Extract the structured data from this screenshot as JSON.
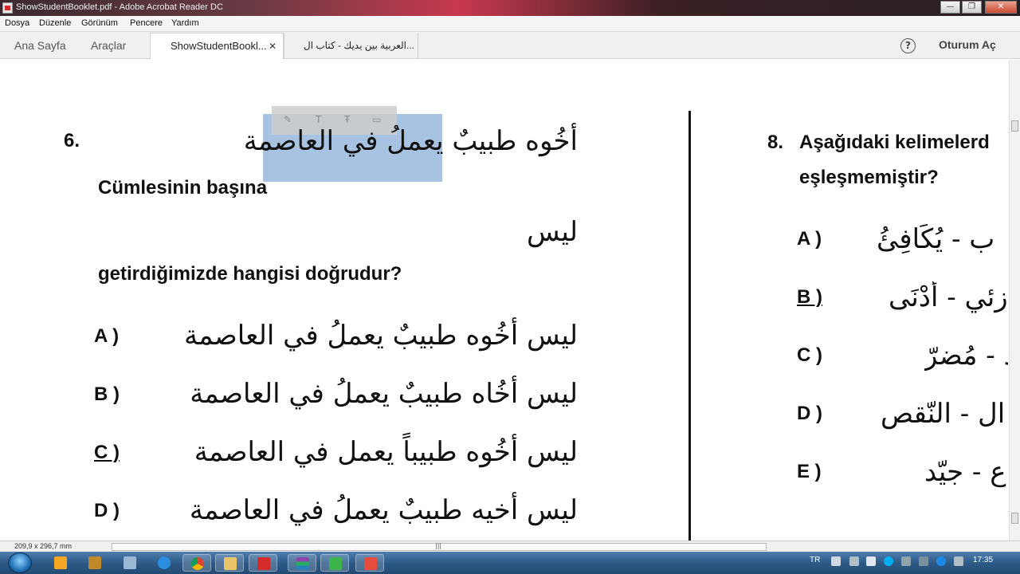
{
  "window": {
    "title": "ShowStudentBooklet.pdf - Adobe Acrobat Reader DC",
    "min_glyph": "—",
    "max_glyph": "❐",
    "close_glyph": "✕"
  },
  "menu": [
    "Dosya",
    "Düzenle",
    "Görünüm",
    "Pencere",
    "Yardım"
  ],
  "nav": {
    "home": "Ana Sayfa",
    "tools": "Araçlar",
    "tabs": [
      {
        "label": "ShowStudentBookl...",
        "close": "✕",
        "active": true
      },
      {
        "label": "العربية بين يديك - كتاب ال...",
        "active": false
      }
    ],
    "help_glyph": "?",
    "signin": "Oturum Aç"
  },
  "selection_toolbar": {
    "icons": [
      "highlight-icon",
      "text-icon",
      "strikethrough-icon",
      "comment-icon"
    ]
  },
  "question6": {
    "number": "6.",
    "sentence": "أخُوه طبيبٌ يعملُ في العاصمة",
    "line1": "Cümlesinin başına",
    "word": "ليس",
    "line2": "getirdiğimizde hangisi doğrudur?",
    "options": [
      {
        "letter": "A )",
        "text": "ليس أخُوه طبيبٌ يعملُ في العاصمة"
      },
      {
        "letter": "B )",
        "text": "ليس أخُاه طبيبٌ يعملُ في العاصمة"
      },
      {
        "letter": "C )",
        "text": "ليس أخُوه طبيباً يعمل في العاصمة",
        "underlined": true
      },
      {
        "letter": "D )",
        "text": "ليس أخيه طبيبٌ يعملُ في العاصمة"
      }
    ]
  },
  "question8": {
    "number": "8.",
    "line1": "Aşağıdaki kelimelerd",
    "line2": "eşleşmemiştir?",
    "options": [
      {
        "letter": "A )",
        "text": "ب - يُكَافِئُ"
      },
      {
        "letter": "B )",
        "text": "زئي - أدْنَى",
        "underlined": true
      },
      {
        "letter": "C )",
        "text": "د - مُضرّ"
      },
      {
        "letter": "D )",
        "text": "ال - النّقص"
      },
      {
        "letter": "E )",
        "text": "ع - جيّد"
      }
    ]
  },
  "status": {
    "page_size": "209,9 x 296,7 mm",
    "scroll_grip": "|||"
  },
  "taskbar": {
    "lang": "TR",
    "time": "17:35",
    "apps": [
      "media-player-icon",
      "app-icon",
      "keyboard-icon",
      "internet-explorer-icon",
      "chrome-icon",
      "file-explorer-icon",
      "acrobat-icon",
      "winrar-icon",
      "camtasia-icon",
      "camtasia-recorder-icon"
    ]
  }
}
